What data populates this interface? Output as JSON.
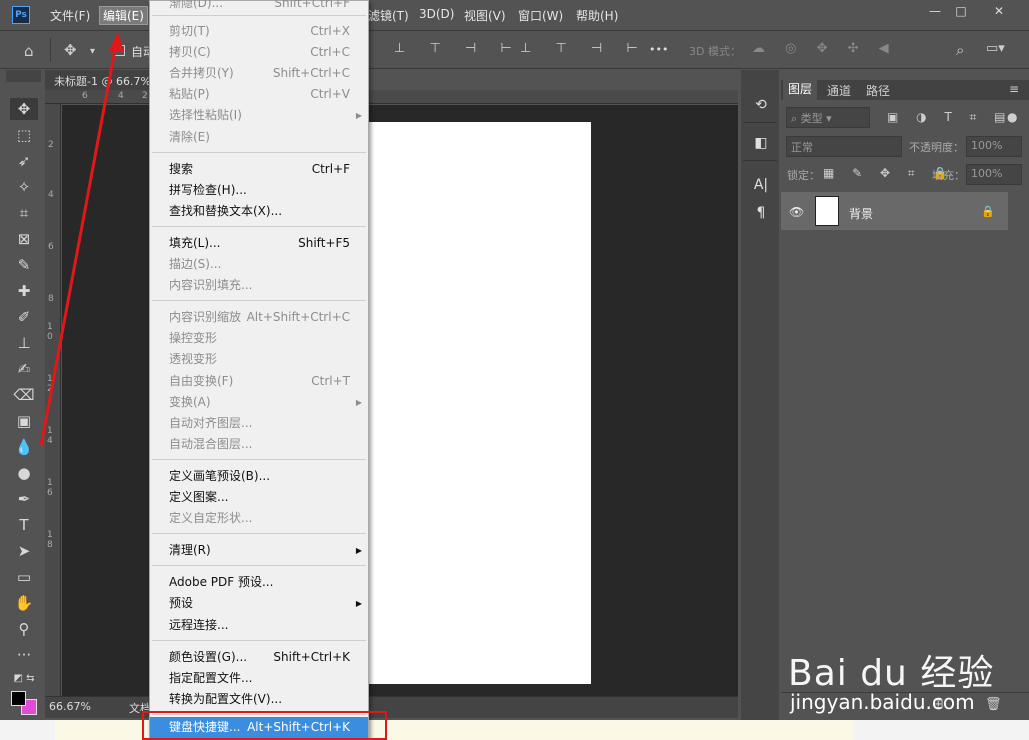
{
  "app": {
    "logo": "Ps",
    "window_controls": {
      "minimize": "—",
      "restore": "□",
      "close": "✕"
    }
  },
  "menubar": {
    "file": "文件(F)",
    "edit": "编辑(E)",
    "filter": "滤镜(T)",
    "threed": "3D(D)",
    "view": "视图(V)",
    "window": "窗口(W)",
    "help": "帮助(H)"
  },
  "optbar": {
    "auto_select": "自动",
    "mode_3d": "3D 模式：",
    "more": "•••"
  },
  "document": {
    "tab_title": "未标题-1 @ 66.7%",
    "zoom": "66.67%",
    "doc_label": "文档",
    "ruler_top": [
      "6",
      "4",
      "2"
    ],
    "ruler_left": [
      "2",
      "4",
      "6",
      "8",
      "1 0",
      "1 2",
      "1 4",
      "1 6",
      "1 8"
    ]
  },
  "edit_menu": {
    "top_partial": {
      "label": "渐隐(D)...",
      "shortcut": "Shift+Ctrl+F"
    },
    "groups": [
      [
        {
          "label": "剪切(T)",
          "shortcut": "Ctrl+X",
          "enabled": false
        },
        {
          "label": "拷贝(C)",
          "shortcut": "Ctrl+C",
          "enabled": false
        },
        {
          "label": "合并拷贝(Y)",
          "shortcut": "Shift+Ctrl+C",
          "enabled": false
        },
        {
          "label": "粘贴(P)",
          "shortcut": "Ctrl+V",
          "enabled": false
        },
        {
          "label": "选择性粘贴(I)",
          "shortcut": "",
          "enabled": false,
          "submenu": true
        },
        {
          "label": "清除(E)",
          "shortcut": "",
          "enabled": false
        }
      ],
      [
        {
          "label": "搜索",
          "shortcut": "Ctrl+F",
          "enabled": true
        },
        {
          "label": "拼写检查(H)...",
          "shortcut": "",
          "enabled": true
        },
        {
          "label": "查找和替换文本(X)...",
          "shortcut": "",
          "enabled": true
        }
      ],
      [
        {
          "label": "填充(L)...",
          "shortcut": "Shift+F5",
          "enabled": true
        },
        {
          "label": "描边(S)...",
          "shortcut": "",
          "enabled": false
        },
        {
          "label": "内容识别填充...",
          "shortcut": "",
          "enabled": false
        }
      ],
      [
        {
          "label": "内容识别缩放",
          "shortcut": "Alt+Shift+Ctrl+C",
          "enabled": false
        },
        {
          "label": "操控变形",
          "shortcut": "",
          "enabled": false
        },
        {
          "label": "透视变形",
          "shortcut": "",
          "enabled": false
        },
        {
          "label": "自由变换(F)",
          "shortcut": "Ctrl+T",
          "enabled": false
        },
        {
          "label": "变换(A)",
          "shortcut": "",
          "enabled": false,
          "submenu": true
        },
        {
          "label": "自动对齐图层...",
          "shortcut": "",
          "enabled": false
        },
        {
          "label": "自动混合图层...",
          "shortcut": "",
          "enabled": false
        }
      ],
      [
        {
          "label": "定义画笔预设(B)...",
          "shortcut": "",
          "enabled": true
        },
        {
          "label": "定义图案...",
          "shortcut": "",
          "enabled": true
        },
        {
          "label": "定义自定形状...",
          "shortcut": "",
          "enabled": false
        }
      ],
      [
        {
          "label": "清理(R)",
          "shortcut": "",
          "enabled": true,
          "submenu": true
        }
      ],
      [
        {
          "label": "Adobe PDF 预设...",
          "shortcut": "",
          "enabled": true
        },
        {
          "label": "预设",
          "shortcut": "",
          "enabled": true,
          "submenu": true
        },
        {
          "label": "远程连接...",
          "shortcut": "",
          "enabled": true
        }
      ],
      [
        {
          "label": "颜色设置(G)...",
          "shortcut": "Shift+Ctrl+K",
          "enabled": true
        },
        {
          "label": "指定配置文件...",
          "shortcut": "",
          "enabled": true
        },
        {
          "label": "转换为配置文件(V)...",
          "shortcut": "",
          "enabled": true
        }
      ]
    ],
    "highlighted": {
      "label": "键盘快捷键...",
      "shortcut": "Alt+Shift+Ctrl+K"
    }
  },
  "layers_panel": {
    "tabs": [
      "图层",
      "通道",
      "路径"
    ],
    "filter_kind": "类型",
    "blend_mode": "正常",
    "opacity_label": "不透明度：",
    "opacity_value": "100%",
    "lock_label": "锁定：",
    "fill_label": "填充：",
    "fill_value": "100%",
    "layer_name": "背景"
  },
  "watermark": {
    "brand": "Bai du 经验",
    "url": "jingyan.baidu.com"
  },
  "colors": {
    "ui_bg": "#535353",
    "menu_bg": "#f0f0f0",
    "highlight": "#3b8de0",
    "annotation": "#e0181a",
    "background_swatch": "#e24bd8"
  }
}
